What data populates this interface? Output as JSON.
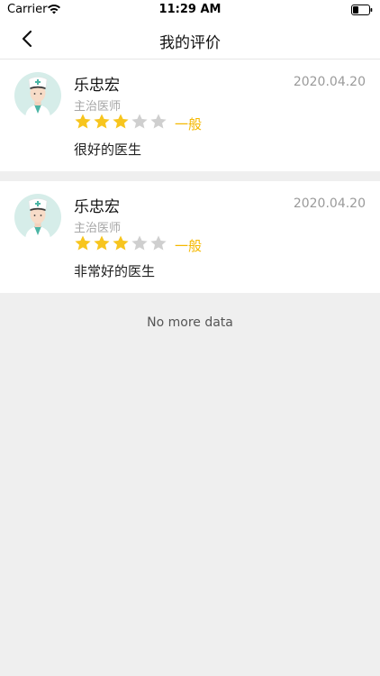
{
  "status_bar": {
    "carrier": "Carrier",
    "time": "11:29 AM"
  },
  "nav": {
    "title": "我的评价",
    "back_icon": "chevron-left-icon"
  },
  "colors": {
    "star_filled": "#f7c51e",
    "star_empty": "#cfcfcf",
    "rating_text": "#f5b800",
    "avatar_bg": "#d6ede9"
  },
  "reviews": [
    {
      "doctor_name": "乐忠宏",
      "doctor_title": "主治医师",
      "date": "2020.04.20",
      "stars_filled": 3,
      "stars_total": 5,
      "rating_label": "一般",
      "comment": "很好的医生"
    },
    {
      "doctor_name": "乐忠宏",
      "doctor_title": "主治医师",
      "date": "2020.04.20",
      "stars_filled": 3,
      "stars_total": 5,
      "rating_label": "一般",
      "comment": "非常好的医生"
    }
  ],
  "footer": {
    "no_more": "No more data"
  }
}
